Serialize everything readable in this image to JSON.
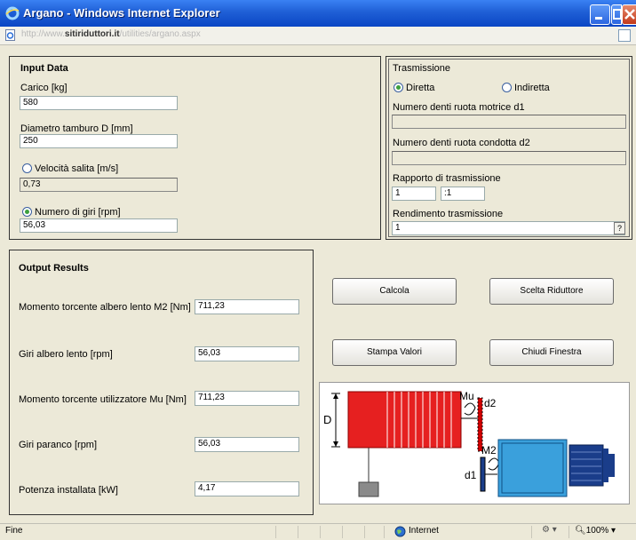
{
  "window": {
    "title": "Argano - Windows Internet Explorer",
    "url_domain": "sitiriduttori.it"
  },
  "input": {
    "header": "Input Data",
    "carico_label": "Carico [kg]",
    "carico_value": "580",
    "diametro_label": "Diametro tamburo D [mm]",
    "diametro_value": "250",
    "velocita_label": "Velocità salita [m/s]",
    "velocita_value": "0,73",
    "giri_label": "Numero di giri [rpm]",
    "giri_value": "56,03"
  },
  "trasmissione": {
    "header": "Trasmissione",
    "diretta_label": "Diretta",
    "indiretta_label": "Indiretta",
    "d1_label": "Numero denti ruota motrice d1",
    "d1_value": "",
    "d2_label": "Numero denti ruota condotta d2",
    "d2_value": "",
    "rapporto_label": "Rapporto di trasmissione",
    "rapporto_left": "1",
    "rapporto_right": ":1",
    "rendimento_label": "Rendimento trasmissione",
    "rendimento_value": "1",
    "help_label": "?"
  },
  "output": {
    "header": "Output Results",
    "rows": [
      {
        "label": "Momento torcente albero lento M2 [Nm]",
        "value": "711,23"
      },
      {
        "label": "Giri albero lento [rpm]",
        "value": "56,03"
      },
      {
        "label": "Momento torcente utilizzatore Mu [Nm]",
        "value": "711,23"
      },
      {
        "label": "Giri paranco [rpm]",
        "value": "56,03"
      },
      {
        "label": "Potenza installata [kW]",
        "value": "4,17"
      }
    ]
  },
  "buttons": {
    "calcola": "Calcola",
    "scelta": "Scelta Riduttore",
    "stampa": "Stampa Valori",
    "chiudi": "Chiudi Finestra"
  },
  "diagram": {
    "label_D": "D",
    "label_Mu": "Mu",
    "label_d2": "d2",
    "label_M2": "M2",
    "label_d1": "d1"
  },
  "status": {
    "left": "Fine",
    "zone": "Internet",
    "zoom": "100%"
  }
}
